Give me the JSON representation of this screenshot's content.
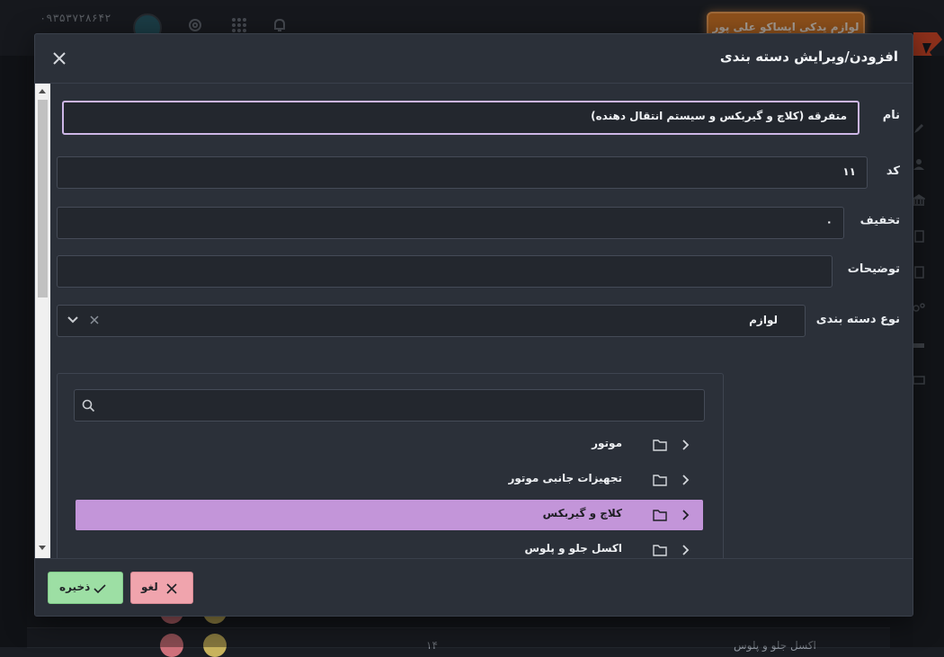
{
  "background": {
    "phone": "۰۹۳۵۳۷۲۸۶۴۲",
    "brand_button": "لوازم یدکی ایساکو علی پور",
    "row_number": "۱۴",
    "row_label": "اکسل جلو و پلوس",
    "accent_color": "#d97b2a"
  },
  "modal": {
    "title": "افزودن/ویرایش دسته بندی",
    "fields": {
      "name": {
        "label": "نام",
        "value": "متفرقه (کلاچ و گیربکس و سیستم انتقال دهنده)"
      },
      "code": {
        "label": "کد",
        "value": "۱۱"
      },
      "discount": {
        "label": "تخفیف",
        "value": "۰"
      },
      "description": {
        "label": "توضیحات",
        "value": ""
      },
      "category_type": {
        "label": "نوع دسته بندی",
        "value": "لوازم"
      }
    },
    "tree": {
      "search_placeholder": "",
      "items": [
        {
          "label": "موتور",
          "selected": false
        },
        {
          "label": "تجهیزات جانبی موتور",
          "selected": false
        },
        {
          "label": "کلاچ و گیربکس",
          "selected": true
        },
        {
          "label": "اکسل جلو و پلوس",
          "selected": false
        }
      ],
      "selected_color": "#c395d9"
    },
    "footer": {
      "save_label": "ذخیره",
      "cancel_label": "لغو",
      "save_color": "#9ddfa4",
      "cancel_color": "#f0a4ad"
    }
  }
}
